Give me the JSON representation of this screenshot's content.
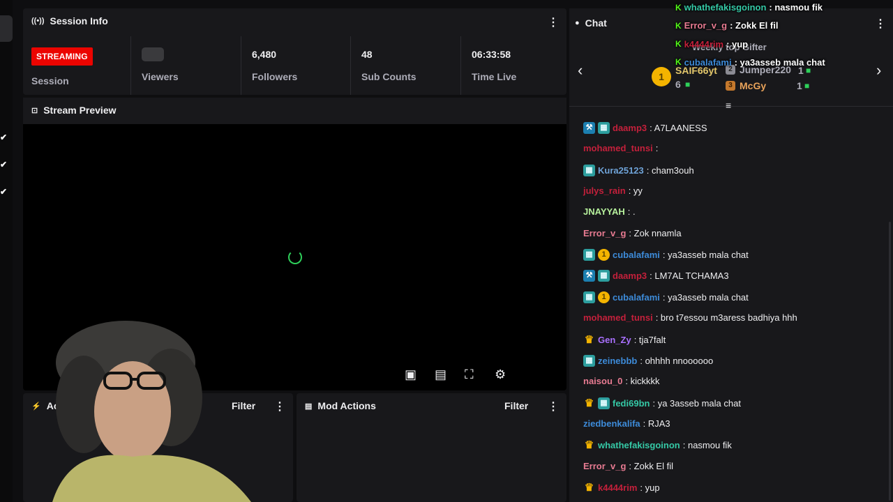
{
  "left_strip": {
    "checks": [
      "✔",
      "✔",
      "✔"
    ]
  },
  "session": {
    "title": "Session Info",
    "status_badge": "STREAMING",
    "session_label": "Session",
    "viewers_label": "Viewers",
    "followers_value": "6,480",
    "followers_label": "Followers",
    "subs_value": "48",
    "subs_label": "Sub Counts",
    "time_value": "06:33:58",
    "time_label": "Time Live"
  },
  "preview": {
    "title": "Stream Preview"
  },
  "activity": {
    "title": "Ac",
    "filter": "Filter"
  },
  "mod_actions": {
    "title": "Mod Actions",
    "filter": "Filter"
  },
  "chat": {
    "title": "Chat",
    "leaderboard": {
      "heading": "Weekly top Gifter",
      "rank1_badge": "1",
      "first": {
        "name": "SAIF66yt",
        "count": "6"
      },
      "second": {
        "name": "Jumper220",
        "count": "1"
      },
      "third": {
        "name": "McGy",
        "count": "1"
      }
    },
    "messages": [
      {
        "badges": [
          "mod",
          "sub"
        ],
        "user": "daamp3",
        "color": "#c4203b",
        "text": ": A7LAANESS"
      },
      {
        "badges": [],
        "user": "mohamed_tunsi",
        "color": "#c4203b",
        "text": ":"
      },
      {
        "badges": [
          "sub"
        ],
        "user": "Kura25123",
        "color": "#6fa3d8",
        "text": ": cham3ouh"
      },
      {
        "badges": [],
        "user": "julys_rain",
        "color": "#c4203b",
        "text": ": yy"
      },
      {
        "badges": [],
        "user": "JNAYYAH",
        "color": "#b6f09c",
        "text": ": ."
      },
      {
        "badges": [],
        "user": "Error_v_g",
        "color": "#e87b92",
        "text": ": Zok nnamla"
      },
      {
        "badges": [
          "sub",
          "gold"
        ],
        "user": "cubalafami",
        "color": "#3d8bd9",
        "text": ": ya3asseb mala chat"
      },
      {
        "badges": [
          "mod",
          "sub"
        ],
        "user": "daamp3",
        "color": "#c4203b",
        "text": ": LM7AL TCHAMA3"
      },
      {
        "badges": [
          "sub",
          "gold"
        ],
        "user": "cubalafami",
        "color": "#3d8bd9",
        "text": ": ya3asseb mala chat"
      },
      {
        "badges": [],
        "user": "mohamed_tunsi",
        "color": "#c4203b",
        "text": ": bro t7essou m3aress badhiya hhh"
      },
      {
        "badges": [
          "crown"
        ],
        "user": "Gen_Zy",
        "color": "#a970ff",
        "text": ": tja7falt"
      },
      {
        "badges": [
          "sub"
        ],
        "user": "zeinebbb",
        "color": "#3d8bd9",
        "text": ": ohhhh nnoooooo"
      },
      {
        "badges": [],
        "user": "naisou_0",
        "color": "#e87b92",
        "text": ": kickkkk"
      },
      {
        "badges": [
          "crown",
          "sub"
        ],
        "user": "fedi69bn",
        "color": "#35c9a6",
        "text": ": ya 3asseb mala chat"
      },
      {
        "badges": [],
        "user": "ziedbenkalifa",
        "color": "#3d8bd9",
        "text": ": RJA3"
      },
      {
        "badges": [
          "crown"
        ],
        "user": "whathefakisgoinon",
        "color": "#35c9a6",
        "text": ": nasmou fik"
      },
      {
        "badges": [],
        "user": "Error_v_g",
        "color": "#e87b92",
        "text": ": Zokk El fil"
      },
      {
        "badges": [
          "crown"
        ],
        "user": "k4444rim",
        "color": "#c4203b",
        "text": ": yup"
      }
    ]
  },
  "overlay_chat": [
    {
      "user": "whathefakisgoinon",
      "color": "#35c9a6",
      "text": " : nasmou fik"
    },
    {
      "user": "Error_v_g",
      "color": "#e87b92",
      "text": " : Zokk El fil"
    },
    {
      "user": "k4444rim",
      "color": "#c4203b",
      "text": " : yup"
    },
    {
      "user": "cubalafami",
      "color": "#3d8bd9",
      "text": " : ya3asseb mala chat"
    }
  ],
  "colors": {
    "accent_live": "#eb0400",
    "kick_green": "#53fc18",
    "panel_bg": "#18181b"
  }
}
